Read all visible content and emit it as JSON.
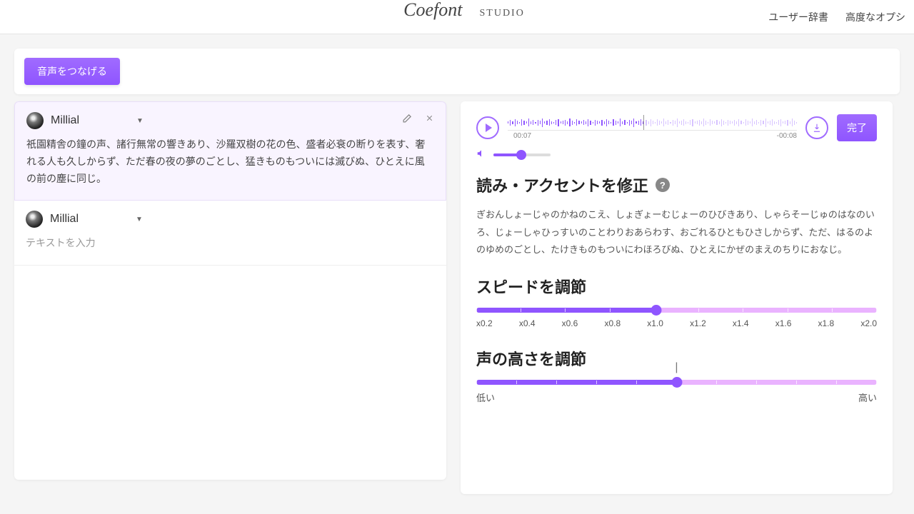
{
  "header": {
    "logo_main": "Coefont",
    "logo_sub": "STUDIO",
    "nav": {
      "dict": "ユーザー辞書",
      "advanced": "高度なオプシ"
    }
  },
  "topbar": {
    "connect": "音声をつなげる"
  },
  "voices": [
    {
      "name": "Millial",
      "text": "祇園精舎の鐘の声、諸行無常の響きあり、沙羅双樹の花の色、盛者必衰の断りを表す、奢れる人も久しからず、ただ春の夜の夢のごとし、猛きものもついには滅びぬ、ひとえに風の前の塵に同じ。"
    },
    {
      "name": "Millial",
      "placeholder": "テキストを入力"
    }
  ],
  "player": {
    "elapsed": "00:07",
    "remaining": "-00:08",
    "done": "完了"
  },
  "accent": {
    "title": "読み・アクセントを修正",
    "reading": "ぎおんしょーじゃのかねのこえ、しょぎょーむじょーのひびきあり、しゃらそーじゅのはなのいろ、じょーしゃひっすいのことわりおあらわす、おごれるひともひさしからず、ただ、はるのよのゆめのごとし、たけきものもついにわほろびぬ、ひとえにかぜのまえのちりにおなじ。"
  },
  "speed": {
    "title": "スピードを調節",
    "ticks": [
      "x0.2",
      "x0.4",
      "x0.6",
      "x0.8",
      "x1.0",
      "x1.2",
      "x1.4",
      "x1.6",
      "x1.8",
      "x2.0"
    ]
  },
  "pitch": {
    "title": "声の高さを調節",
    "low": "低い",
    "mid": "|",
    "high": "高い"
  }
}
